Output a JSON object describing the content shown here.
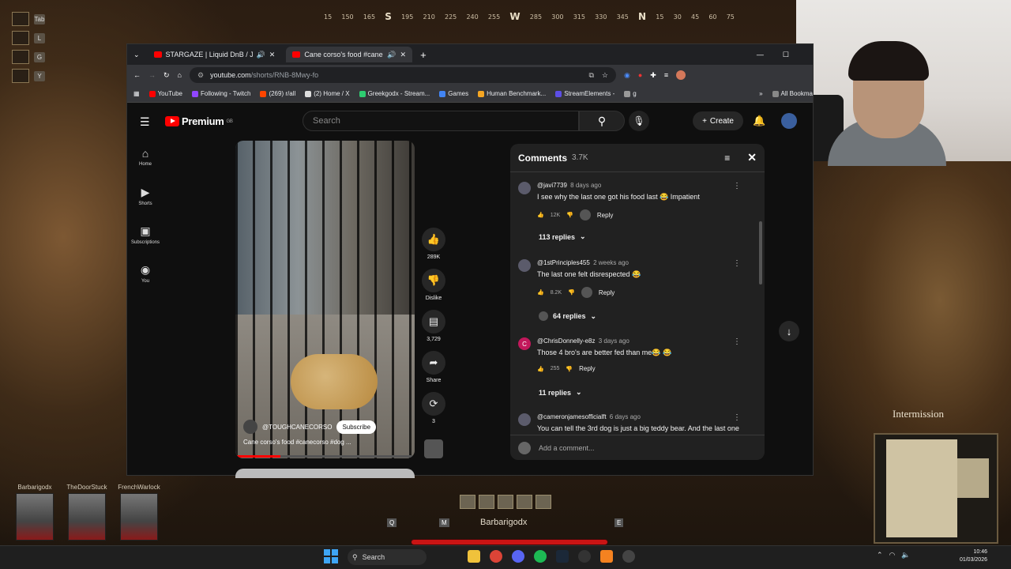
{
  "game": {
    "compass": [
      "15",
      "150",
      "165",
      "S",
      "195",
      "210",
      "225",
      "240",
      "255",
      "W",
      "285",
      "300",
      "315",
      "330",
      "345",
      "N",
      "15",
      "30",
      "45",
      "60",
      "75"
    ],
    "hotkeys": [
      "Tab",
      "L",
      "G",
      "Y"
    ],
    "intermission": "Intermission",
    "party": [
      "Barbarigodx",
      "TheDoorStuck",
      "FrenchWarlock"
    ],
    "player_name": "Barbarigodx",
    "keys": {
      "q": "Q",
      "m": "M",
      "e": "E"
    }
  },
  "browser": {
    "tabs": [
      {
        "title": "STARGAZE | Liquid DnB / Ju",
        "active": false
      },
      {
        "title": "Cane corso's food #caneco",
        "active": true
      }
    ],
    "url_host": "youtube.com",
    "url_path": "/shorts/RNB-8Mwy-fo",
    "bookmarks": [
      {
        "label": "YouTube",
        "color": "#ff0000"
      },
      {
        "label": "Following - Twitch",
        "color": "#9146ff"
      },
      {
        "label": "(269) r/all",
        "color": "#ff4500"
      },
      {
        "label": "(2) Home / X",
        "color": "#dddddd"
      },
      {
        "label": "Greekgodx - Stream...",
        "color": "#2ecc71"
      },
      {
        "label": "Games",
        "color": "#4285f4"
      },
      {
        "label": "Human Benchmark...",
        "color": "#f5a623"
      },
      {
        "label": "StreamElements -",
        "color": "#5c4ee5"
      },
      {
        "label": "g",
        "color": "#999999"
      }
    ],
    "all_bookmarks": "All Bookma"
  },
  "youtube": {
    "logo": "Premium",
    "logo_region": "GB",
    "search_placeholder": "Search",
    "create_label": "Create",
    "nav": [
      {
        "label": "Home",
        "icon": "home-icon"
      },
      {
        "label": "Shorts",
        "icon": "shorts-icon"
      },
      {
        "label": "Subscriptions",
        "icon": "subscriptions-icon"
      },
      {
        "label": "You",
        "icon": "you-icon"
      }
    ],
    "video": {
      "channel": "@TOUGHCANECORSO",
      "subscribe": "Subscribe",
      "title": "Cane corso's food #canecorso #dog ...",
      "progress": 0.25
    },
    "actions": {
      "likes": "289K",
      "dislike": "Dislike",
      "comments": "3,729",
      "share": "Share",
      "remix": "3"
    },
    "comments_panel": {
      "title": "Comments",
      "count": "3.7K",
      "add_placeholder": "Add a comment...",
      "items": [
        {
          "user": "@javi7739",
          "ago": "8 days ago",
          "text": "I see why the last one got his food last 😂 Impatient",
          "likes": "12K",
          "reply": "Reply",
          "replies": "113 replies"
        },
        {
          "user": "@1stPrinciples455",
          "ago": "2 weeks ago",
          "text": "The last one felt disrespected 😂",
          "likes": "8.2K",
          "reply": "Reply",
          "replies": "64 replies"
        },
        {
          "user": "@ChrisDonnelly-e8z",
          "ago": "3 days ago",
          "text": "Those 4 bro's are better fed than me😂 😂",
          "likes": "255",
          "reply": "Reply",
          "replies": "11 replies",
          "initial": "C"
        },
        {
          "user": "@cameronjamesofficialft",
          "ago": "6 days ago",
          "text": "You can tell the 3rd dog is just a big teddy bear. And the last one"
        }
      ]
    }
  },
  "taskbar": {
    "search": "Search",
    "time": "10:46",
    "date": "01/03/2026"
  }
}
